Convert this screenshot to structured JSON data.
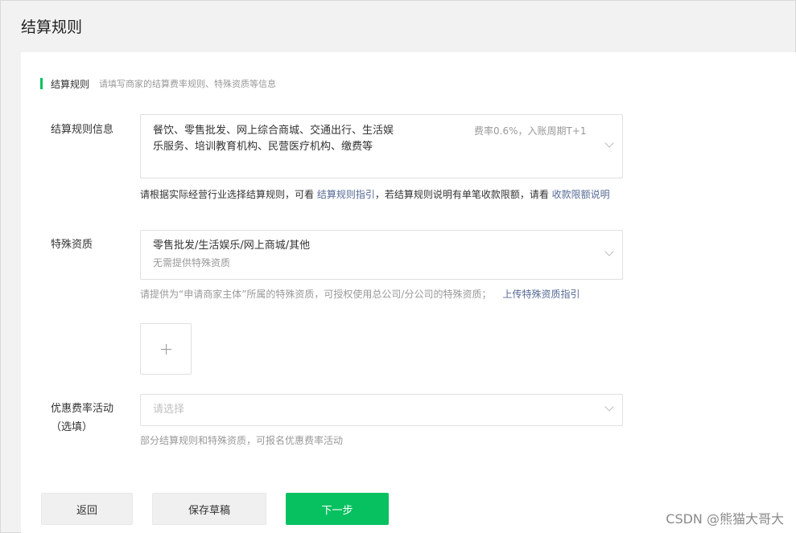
{
  "page": {
    "title": "结算规则"
  },
  "section": {
    "title": "结算规则",
    "subtitle": "请填写商家的结算费率规则、特殊资质等信息",
    "accent": "#07c160"
  },
  "settlement": {
    "label": "结算规则信息",
    "value": "餐饮、零售批发、网上综合商城、交通出行、生活娱乐服务、培训教育机构、民营医疗机构、缴费等",
    "rate": "费率0.6%，入账周期T+1",
    "hint_prefix": "请根据实际经营行业选择结算规则，可看 ",
    "hint_link1": "结算规则指引",
    "hint_mid": "，若结算规则说明有单笔收款限额，请看 ",
    "hint_link2": "收款限额说明",
    "link_color": "#576b95"
  },
  "qualification": {
    "label": "特殊资质",
    "value": "零售批发/生活娱乐/网上商城/其他",
    "sub": "无需提供特殊资质",
    "hint": "请提供为“申请商家主体”所属的特殊资质，可授权使用总公司/分公司的特殊资质；",
    "hint_link": "上传特殊资质指引",
    "upload_icon": "plus-icon"
  },
  "discount": {
    "label_line1": "优惠费率活动",
    "label_line2": "（选填）",
    "placeholder": "请选择",
    "hint": "部分结算规则和特殊资质，可报名优惠费率活动"
  },
  "buttons": {
    "back": "返回",
    "save_draft": "保存草稿",
    "next": "下一步",
    "primary_color": "#07c160"
  },
  "watermark": "CSDN @熊猫大哥大"
}
